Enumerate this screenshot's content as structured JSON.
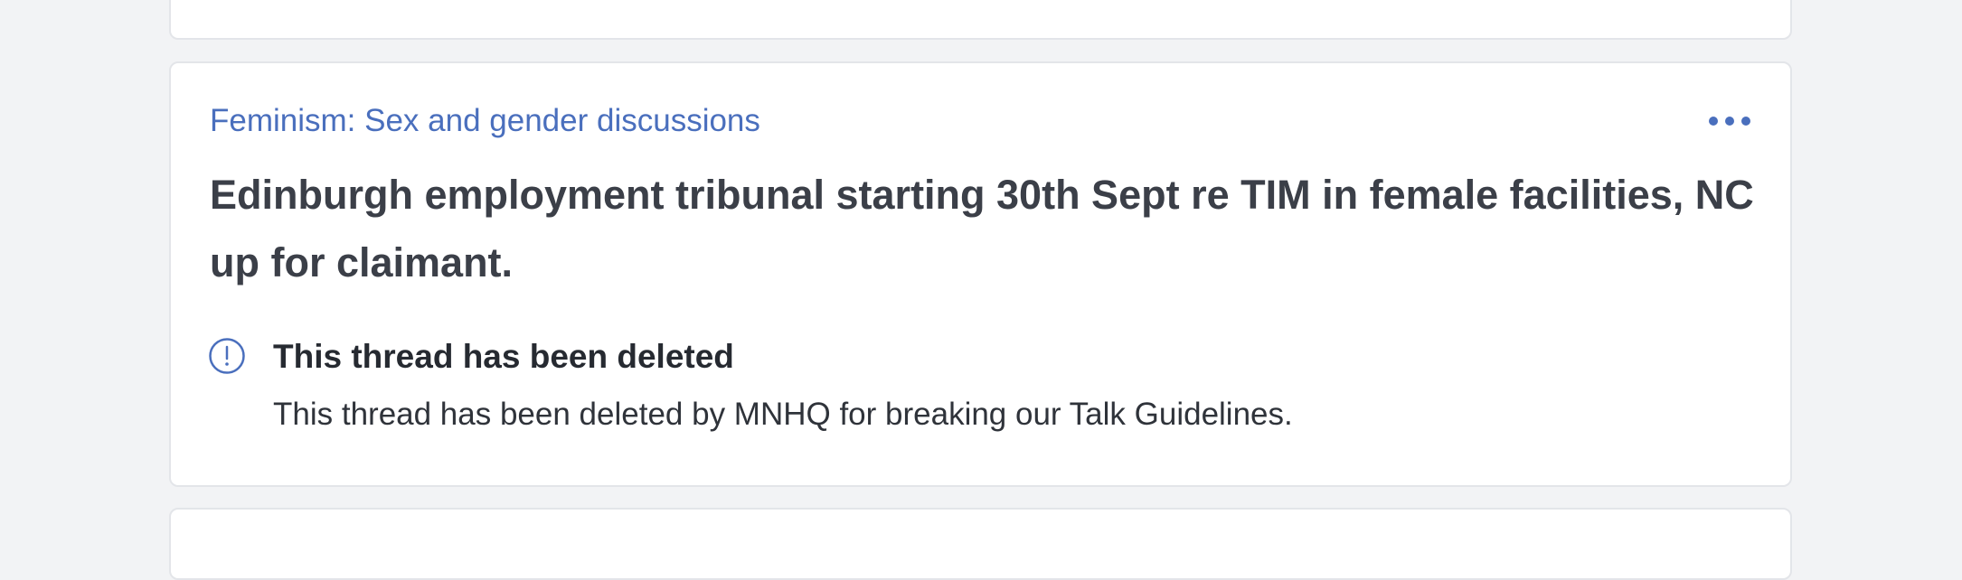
{
  "thread": {
    "category": "Feminism: Sex and gender discussions",
    "title": "Edinburgh employment tribunal starting 30th Sept re TIM in female facilities, NC up for claimant.",
    "more_icon": "more-horizontal-icon",
    "notice": {
      "icon": "info-circle-icon",
      "heading": "This thread has been deleted",
      "body": "This thread has been deleted by MNHQ for breaking our Talk Guidelines."
    }
  },
  "colors": {
    "accent": "#4a6fbd",
    "title_text": "#3b3f48",
    "page_background": "#f2f3f5",
    "card_background": "#ffffff"
  }
}
